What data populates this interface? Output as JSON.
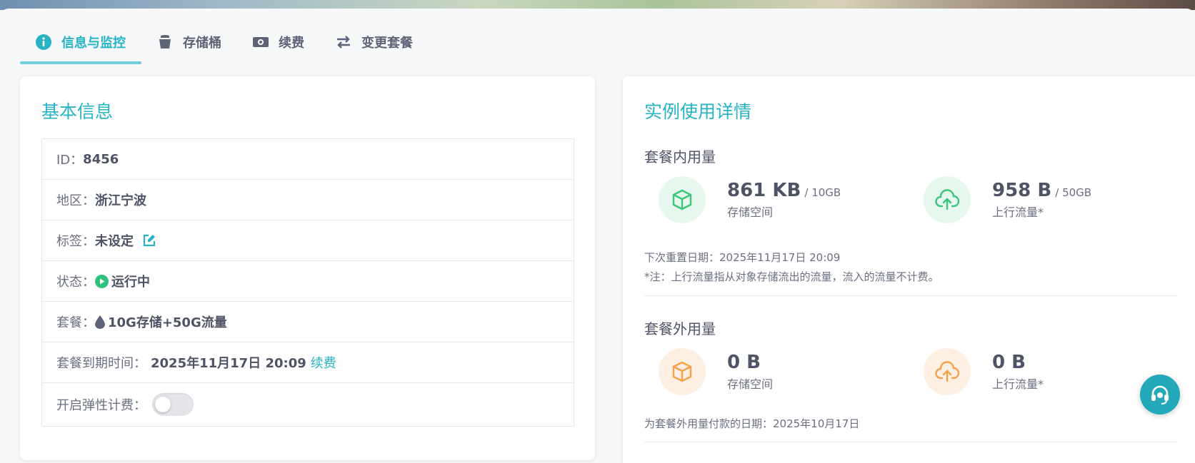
{
  "tabs": [
    {
      "label": "信息与监控",
      "icon": "info-icon"
    },
    {
      "label": "存储桶",
      "icon": "bucket-icon"
    },
    {
      "label": "续费",
      "icon": "money-icon"
    },
    {
      "label": "变更套餐",
      "icon": "swap-icon"
    }
  ],
  "basic": {
    "title": "基本信息",
    "id_label": "ID：",
    "id_value": "8456",
    "region_label": "地区：",
    "region_value": "浙江宁波",
    "tag_label": "标签：",
    "tag_value": "未设定",
    "status_label": "状态：",
    "status_value": "运行中",
    "plan_label": "套餐：",
    "plan_value": "10G存储+50G流量",
    "expire_label": "套餐到期时间：",
    "expire_value": "2025年11月17日 20:09",
    "renew_link": "续费",
    "elastic_label": "开启弹性计费：",
    "elastic_on": false
  },
  "usage": {
    "title": "实例使用详情",
    "in_plan_title": "套餐内用量",
    "storage_value": "861 KB",
    "storage_quota": "/ 10GB",
    "storage_label": "存储空间",
    "traffic_value": "958 B",
    "traffic_quota": "/ 50GB",
    "traffic_label": "上行流量*",
    "reset_note": "下次重置日期：2025年11月17日 20:09",
    "traffic_note": "*注：上行流量指从对象存储流出的流量，流入的流量不计费。",
    "out_plan_title": "套餐外用量",
    "out_storage_value": "0 B",
    "out_storage_label": "存储空间",
    "out_traffic_value": "0 B",
    "out_traffic_label": "上行流量*",
    "pay_note": "为套餐外用量付款的日期：2025年10月17日"
  },
  "colors": {
    "accent": "#27b3c4",
    "green": "#3cc47c",
    "orange": "#f5a04a",
    "running": "#2ec27e"
  }
}
